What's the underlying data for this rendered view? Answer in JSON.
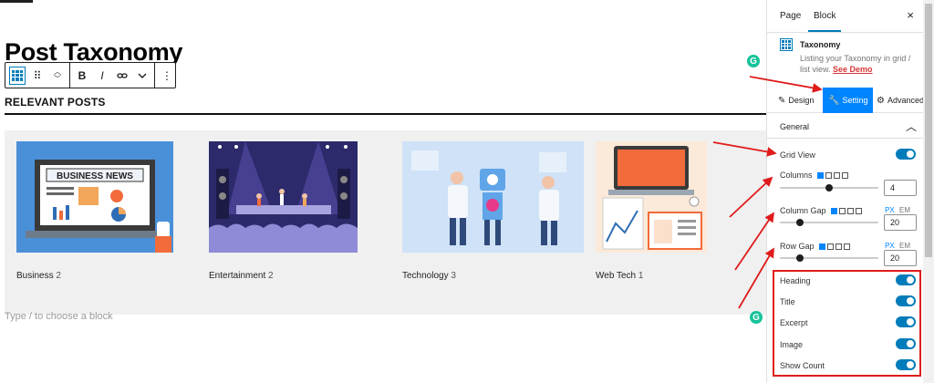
{
  "editor": {
    "post_title": "Post Taxonomy",
    "section_heading": "RELEVANT POSTS",
    "placeholder": "Type / to choose a block",
    "toolbar": {
      "bold_label": "B",
      "italic_label": "I",
      "drag_icon": "drag-handle-icon",
      "move_icon": "move-up-down-icon",
      "link_icon": "link-icon",
      "more_icon": "chevron-down-icon",
      "options_icon": "more-vertical-icon"
    },
    "taxonomies": [
      {
        "name": "Business",
        "count": "2"
      },
      {
        "name": "Entertainment",
        "count": "2"
      },
      {
        "name": "Technology",
        "count": "3"
      },
      {
        "name": "Web Tech",
        "count": "1"
      }
    ],
    "business_image_text": "BUSINESS NEWS"
  },
  "sidebar": {
    "tabs": [
      "Page",
      "Block"
    ],
    "close": "×",
    "block": {
      "name": "Taxonomy",
      "description": "Listing your Taxonomy in grid / list view.",
      "demo_link": "See Demo"
    },
    "mode_tabs": [
      "Design",
      "Setting",
      "Advanced"
    ],
    "panel_title": "General",
    "controls": {
      "grid_view": "Grid View",
      "columns": {
        "label": "Columns",
        "value": "4"
      },
      "column_gap": {
        "label": "Column Gap",
        "value": "20",
        "units": [
          "PX",
          "EM"
        ]
      },
      "row_gap": {
        "label": "Row Gap",
        "value": "20",
        "units": [
          "PX",
          "EM"
        ]
      },
      "toggles": [
        "Heading",
        "Title",
        "Excerpt",
        "Image",
        "Show Count"
      ]
    }
  },
  "colors": {
    "accent": "#007cba",
    "setting_tab": "#0085ff",
    "annotation": "#e01b1b",
    "grammarly": "#15c39a"
  }
}
